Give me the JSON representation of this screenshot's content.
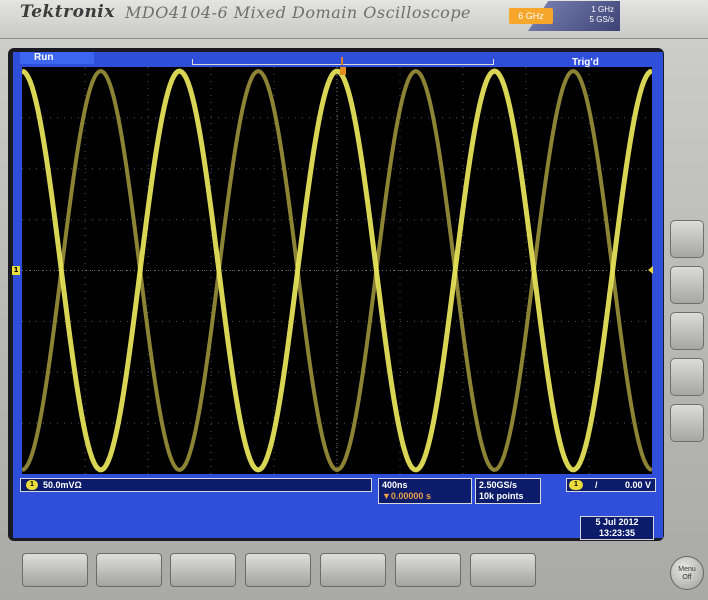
{
  "header": {
    "brand": "Tektronix",
    "model": "MDO4104-6",
    "title": "Mixed Domain Oscilloscope",
    "rf_badge": "6 GHz",
    "spec_line1": "1 GHz",
    "spec_line2": "5 GS/s"
  },
  "status": {
    "acquisition": "Run",
    "trigger_state": "Trig'd"
  },
  "channel1": {
    "badge": "1",
    "scale": "50.0mVΩ"
  },
  "timebase": {
    "scale": "400ns",
    "delay": "▼0.00000 s",
    "sample_rate": "2.50GS/s",
    "record_length": "10k points"
  },
  "trigger": {
    "source_badge": "1",
    "slope": "/",
    "level": "0.00 V"
  },
  "datetime": {
    "date": "5 Jul  2012",
    "time": "13:23:35"
  },
  "menu_button": {
    "line1": "Menu",
    "line2": "Off"
  },
  "waveform": {
    "color": "#e6e25a",
    "ghost_color": "#a59a3e",
    "cycles_visible": 4
  },
  "colors": {
    "screen_blue": "#2f4fdb",
    "readout_bg": "#0c1c6a",
    "trace_yellow": "#e9dc3b"
  }
}
